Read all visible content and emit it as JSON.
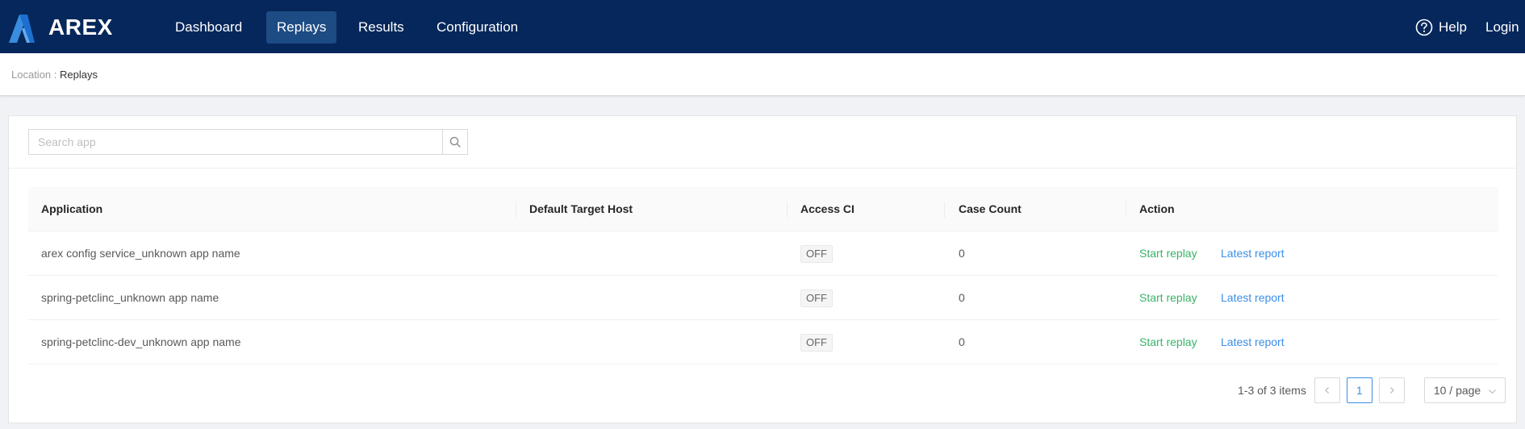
{
  "app": {
    "brand": "AREX"
  },
  "nav": [
    {
      "label": "Dashboard",
      "active": false
    },
    {
      "label": "Replays",
      "active": true
    },
    {
      "label": "Results",
      "active": false
    },
    {
      "label": "Configuration",
      "active": false
    }
  ],
  "header_right": {
    "help": "Help",
    "login": "Login"
  },
  "breadcrumb": {
    "location_label": "Location : ",
    "current": "Replays"
  },
  "search": {
    "placeholder": "Search app",
    "value": ""
  },
  "table": {
    "columns": [
      "Application",
      "Default Target Host",
      "Access CI",
      "Case Count",
      "Action"
    ],
    "rows": [
      {
        "application": "arex config service_unknown app name",
        "target_host": "",
        "access_ci": "OFF",
        "case_count": "0",
        "start": "Start replay",
        "report": "Latest report"
      },
      {
        "application": "spring-petclinc_unknown app name",
        "target_host": "",
        "access_ci": "OFF",
        "case_count": "0",
        "start": "Start replay",
        "report": "Latest report"
      },
      {
        "application": "spring-petclinc-dev_unknown app name",
        "target_host": "",
        "access_ci": "OFF",
        "case_count": "0",
        "start": "Start replay",
        "report": "Latest report"
      }
    ]
  },
  "pagination": {
    "total_text": "1-3 of 3 items",
    "current_page": "1",
    "page_size": "10 / page"
  },
  "colors": {
    "header_bg": "#06275b",
    "active_nav": "#1d4b84",
    "start_action": "#38b368",
    "report_action": "#3b8ee8"
  },
  "icons": {
    "logo": "arex-logo",
    "help": "question-circle-icon",
    "search": "search-icon",
    "prev": "chevron-left-icon",
    "next": "chevron-right-icon",
    "select": "chevron-down-icon"
  }
}
